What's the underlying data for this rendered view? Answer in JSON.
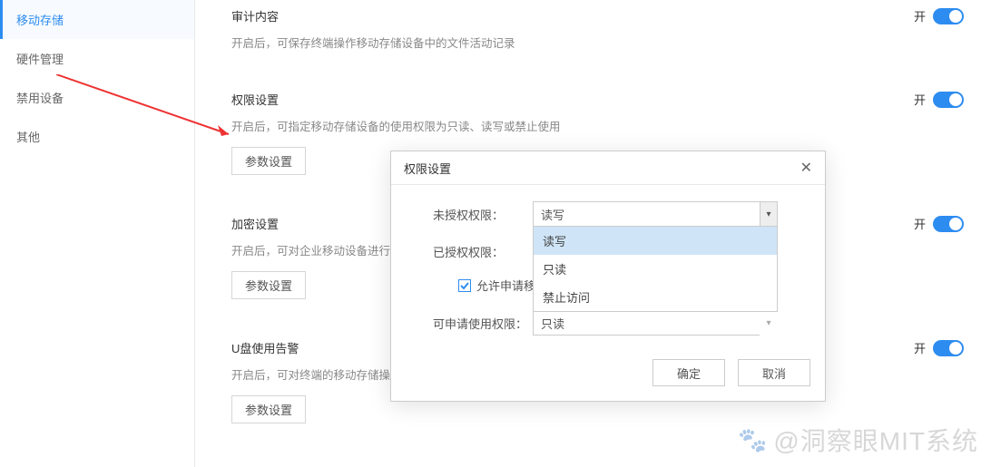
{
  "sidebar": {
    "items": [
      {
        "label": "移动存储"
      },
      {
        "label": "硬件管理"
      },
      {
        "label": "禁用设备"
      },
      {
        "label": "其他"
      }
    ]
  },
  "sections": {
    "audit": {
      "title": "审计内容",
      "desc": "开启后，可保存终端操作移动存储设备中的文件活动记录",
      "toggle_label": "开"
    },
    "perm": {
      "title": "权限设置",
      "desc": "开启后，可指定移动存储设备的使用权限为只读、读写或禁止使用",
      "toggle_label": "开",
      "param_btn": "参数设置"
    },
    "encrypt": {
      "title": "加密设置",
      "desc": "开启后，可对企业移动设备进行加",
      "toggle_label": "开",
      "param_btn": "参数设置"
    },
    "ualarm": {
      "title": "U盘使用告警",
      "desc": "开启后，可对终端的移动存储操作",
      "toggle_label": "开",
      "param_btn": "参数设置"
    }
  },
  "dialog": {
    "title": "权限设置",
    "unauth_label": "未授权权限：",
    "authed_label": "已授权权限：",
    "unauth_value": "读写",
    "options": [
      "读写",
      "只读",
      "禁止访问"
    ],
    "approve_checkbox": "允许申请移动存储使用审批",
    "apply_perm_label": "可申请使用权限：",
    "apply_perm_value": "只读",
    "ok": "确定",
    "cancel": "取消"
  },
  "watermark": "@洞察眼MIT系统"
}
